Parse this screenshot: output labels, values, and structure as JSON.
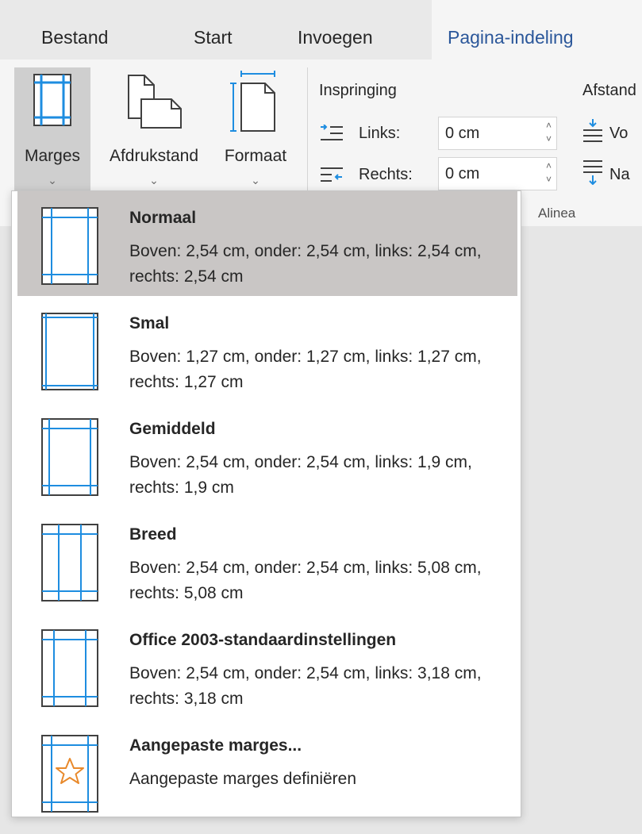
{
  "tabs": [
    {
      "label": "Bestand"
    },
    {
      "label": "Start"
    },
    {
      "label": "Invoegen"
    },
    {
      "label": "Pagina-indeling"
    }
  ],
  "ribbon": {
    "margins_label": "Marges",
    "orientation_label": "Afdrukstand",
    "size_label": "Formaat",
    "indent": {
      "title": "Inspringing",
      "left_label": "Links:",
      "left_value": "0 cm",
      "right_label": "Rechts:",
      "right_value": "0 cm"
    },
    "spacing": {
      "title": "Afstand",
      "before_label": "Vo",
      "after_label": "Na"
    },
    "paragraph_group": "Alinea"
  },
  "margins_menu": [
    {
      "title": "Normaal",
      "desc": "Boven: 2,54 cm, onder: 2,54 cm, links: 2,54 cm, rechts: 2,54 cm",
      "selected": true
    },
    {
      "title": "Smal",
      "desc": "Boven: 1,27 cm, onder: 1,27 cm, links: 1,27 cm, rechts: 1,27 cm"
    },
    {
      "title": "Gemiddeld",
      "desc": "Boven: 2,54 cm, onder: 2,54 cm, links: 1,9 cm, rechts: 1,9 cm"
    },
    {
      "title": "Breed",
      "desc": "Boven: 2,54 cm, onder: 2,54 cm, links: 5,08 cm, rechts: 5,08 cm"
    },
    {
      "title": "Office 2003-standaardinstellingen",
      "desc": "Boven: 2,54 cm, onder: 2,54 cm, links: 3,18 cm, rechts: 3,18 cm"
    },
    {
      "title": "Aangepaste marges...",
      "desc": "Aangepaste marges definiëren"
    }
  ],
  "colors": {
    "accent_tab": "#2b579a",
    "margin_line": "#1e8de0",
    "star": "#e8892b",
    "selected_bg": "#c9c6c5"
  }
}
